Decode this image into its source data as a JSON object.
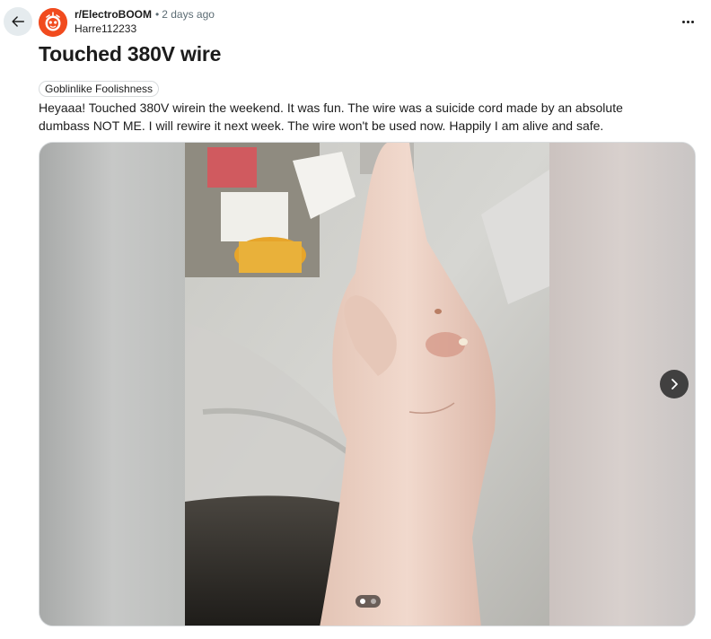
{
  "post": {
    "subreddit": "r/ElectroBOOM",
    "separator": "•",
    "time_ago": "2 days ago",
    "author": "Harre112233",
    "title": "Touched 380V wire",
    "flair": "Goblinlike Foolishness",
    "body": "Heyaaa! Touched 380V wirein the weekend. It was fun. The wire was a suicide cord made by an absolute dumbass NOT ME. I will rewire it next week. The wire won't be used now. Happily I am alive and safe."
  },
  "gallery": {
    "image_count": 2,
    "current_index": 1
  },
  "icons": {
    "back": "arrow-left-icon",
    "more": "ellipsis-icon",
    "next": "chevron-right-icon",
    "avatar": "subreddit-avatar"
  },
  "colors": {
    "avatar_bg": "#f14b1e",
    "flair_border": "#d7dadc",
    "back_button_bg": "#e5ebee"
  }
}
